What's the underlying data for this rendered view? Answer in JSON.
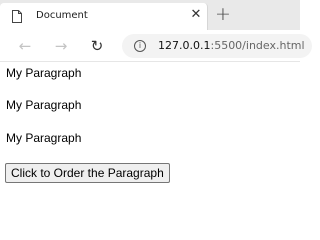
{
  "browser": {
    "tab": {
      "title": "Document",
      "close_glyph": "✕",
      "icon": "page-icon"
    },
    "new_tab_glyph": "+",
    "nav": {
      "back_glyph": "←",
      "forward_glyph": "→",
      "reload_glyph": "↻"
    },
    "address": {
      "info_glyph": "i",
      "host": "127.0.0.1",
      "path": ":5500/index.html"
    }
  },
  "page": {
    "paragraphs": [
      "My Paragraph",
      "My Paragraph",
      "My Paragraph"
    ],
    "button_label": "Click to Order the Paragraph"
  }
}
